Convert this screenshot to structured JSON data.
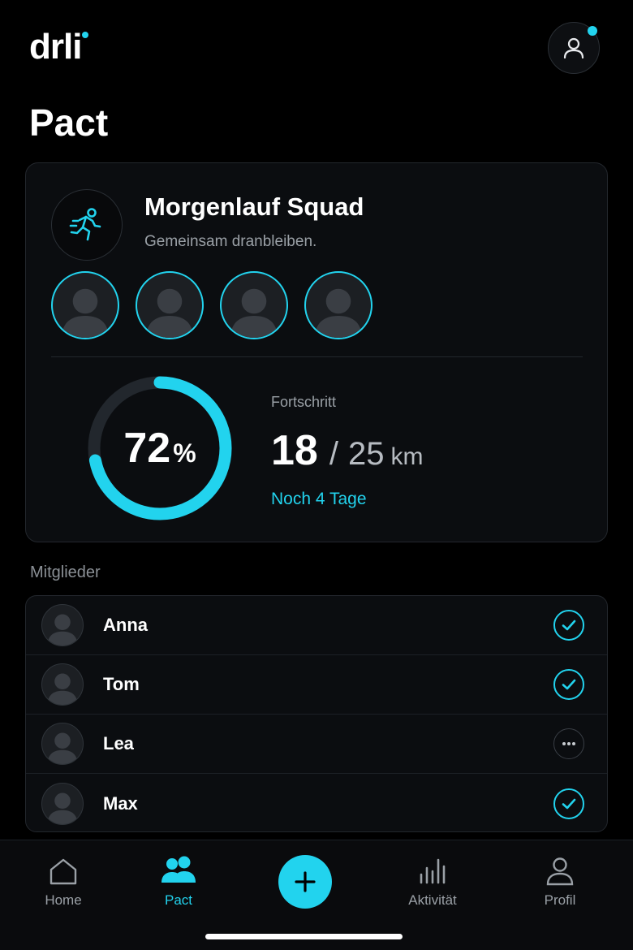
{
  "app": {
    "logo": "drli"
  },
  "page": {
    "title": "Pact"
  },
  "pact": {
    "name": "Morgenlauf Squad",
    "subtitle": "Gemeinsam dranbleiben.",
    "icon": "running-icon",
    "progress": {
      "percent": 72,
      "percent_value": "72",
      "percent_sign": "%",
      "label": "Fortschritt",
      "current": "18",
      "separator": "/",
      "target": "25",
      "unit": "km",
      "remaining": "Noch 4 Tage"
    }
  },
  "members": {
    "label": "Mitglieder",
    "items": [
      {
        "name": "Anna",
        "status": "done"
      },
      {
        "name": "Tom",
        "status": "done"
      },
      {
        "name": "Lea",
        "status": "pending"
      },
      {
        "name": "Max",
        "status": "done"
      }
    ]
  },
  "tabbar": {
    "home": "Home",
    "pact": "Pact",
    "activity": "Aktivität",
    "profile": "Profil",
    "active": "pact"
  },
  "colors": {
    "accent": "#22d3ee",
    "background": "#000000",
    "card": "#0b0d10",
    "muted_text": "#9aa0a6"
  }
}
